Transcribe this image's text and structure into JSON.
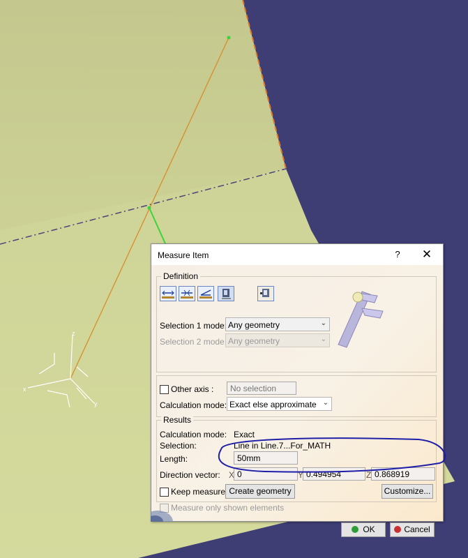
{
  "dialog": {
    "title": "Measure Item",
    "help_glyph": "?",
    "close_glyph": "✕",
    "definition_label": "Definition",
    "toolbar_icons": [
      "measure-between-icon",
      "measure-between-chain-icon",
      "measure-between-fan-icon",
      "measure-item-icon",
      "measure-thickness-icon"
    ],
    "selection1_label": "Selection 1 mode:",
    "selection1_value": "Any geometry",
    "selection2_label": "Selection 2 mode:",
    "selection2_value": "Any geometry",
    "other_axis_label": "Other axis :",
    "other_axis_value": "No selection",
    "calc_mode_label": "Calculation mode:",
    "calc_mode_value": "Exact else approximate",
    "results_label": "Results",
    "result_calc_mode_label": "Calculation mode:",
    "result_calc_mode_value": "Exact",
    "result_selection_label": "Selection:",
    "result_selection_value": "Line in Line.7...For_MATH",
    "length_label": "Length:",
    "length_value": "50mm",
    "direction_label": "Direction vector:",
    "dir_x_label": "X",
    "dir_x_value": "0",
    "dir_y_label": "Y",
    "dir_y_value": "0.494954",
    "dir_z_label": "Z",
    "dir_z_value": "0.868919",
    "keep_measure_label": "Keep measure",
    "create_geometry_label": "Create geometry",
    "customize_label": "Customize...",
    "shown_only_label": "Measure only shown elements",
    "ok_label": "OK",
    "cancel_label": "Cancel"
  },
  "viewport": {
    "axis_labels": [
      "x",
      "y",
      "z"
    ],
    "colors": {
      "plane_light": "#c9cf95",
      "background_dark": "#3d3c73",
      "line_orange": "#d98c2a",
      "point_green": "#3cd43c",
      "highlight_blue": "#1e1ea8"
    }
  }
}
